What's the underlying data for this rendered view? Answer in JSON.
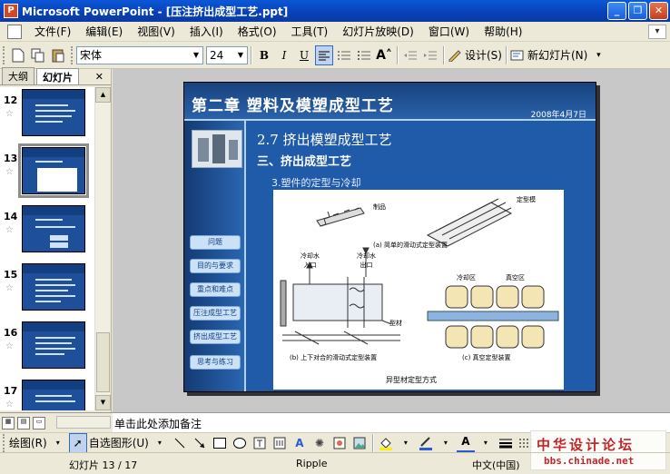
{
  "window": {
    "title": "Microsoft PowerPoint - [压注挤出成型工艺.ppt]",
    "min": "_",
    "restore": "❐",
    "close": "✕"
  },
  "menu": [
    "文件(F)",
    "编辑(E)",
    "视图(V)",
    "插入(I)",
    "格式(O)",
    "工具(T)",
    "幻灯片放映(D)",
    "窗口(W)",
    "帮助(H)"
  ],
  "toolbar": {
    "font": "宋体",
    "size": "24",
    "bold": "B",
    "italic": "I",
    "underline": "U",
    "design": "设计(S)",
    "new_slide": "新幻灯片(N)"
  },
  "panel": {
    "tab_outline": "大纲",
    "tab_slides": "幻灯片",
    "close": "✕"
  },
  "thumbnails": [
    {
      "num": "12",
      "selected": false
    },
    {
      "num": "13",
      "selected": true
    },
    {
      "num": "14",
      "selected": false
    },
    {
      "num": "15",
      "selected": false
    },
    {
      "num": "16",
      "selected": false
    },
    {
      "num": "17",
      "selected": false
    }
  ],
  "slide": {
    "title": "第二章 塑料及模塑成型工艺",
    "date": "2008年4月7日",
    "h1": "2.7 挤出模塑成型工艺",
    "h2": "三、挤出成型工艺",
    "h3": "3.塑件的定型与冷却",
    "nav": [
      "问题",
      "目的与要求",
      "重点和难点",
      "压注成型工艺",
      "挤出成型工艺",
      "思考与练习"
    ],
    "figure": {
      "label_product": "制品",
      "label_mold": "定型模",
      "caption_a": "(a) 简单的滑动式定型装置",
      "label_in": "冷却水\n入口",
      "label_out": "冷却水\n出口",
      "label_material": "型材",
      "label_cool": "冷却区",
      "label_vacuum": "真空区",
      "caption_b": "(b) 上下对合的滑动式定型装置",
      "caption_c": "(c) 真空定型装置",
      "caption_main": "异型材定型方式"
    }
  },
  "notes": "单击此处添加备注",
  "drawbar": {
    "draw": "绘图(R)",
    "autoshape": "自选图形(U)"
  },
  "status": {
    "slide": "幻灯片 13 / 17",
    "design": "Ripple",
    "lang": "中文(中国)"
  },
  "watermark": {
    "line1": "中华设计论坛",
    "line2": "bbs.chinade.net"
  },
  "colors": {
    "slide_bg": "#1f5ba8",
    "titlebar": "#0a58d6"
  }
}
